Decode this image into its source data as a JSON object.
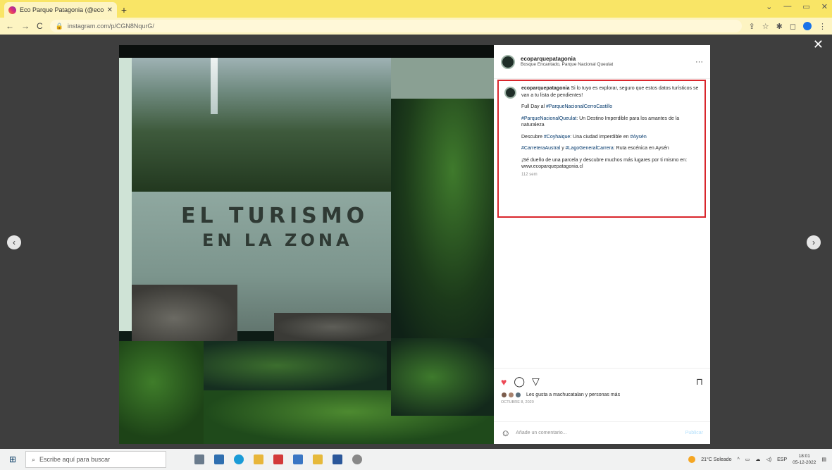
{
  "browser": {
    "tab_title": "Eco Parque Patagonia (@ecopar...",
    "tab_close": "✕",
    "new_tab": "+",
    "url": "instagram.com/p/CGN8NqurG/",
    "window_controls": [
      "⌄",
      "—",
      "▭",
      "✕"
    ]
  },
  "overlay": {
    "close": "✕",
    "prev": "‹",
    "next": "›"
  },
  "post_image": {
    "title_line1": "EL TURISMO",
    "title_line2": "EN LA ZONA"
  },
  "post": {
    "username": "ecoparquepatagonia",
    "location": "Bosque Encantado, Parque Nacional Queulat",
    "more": "···",
    "caption": {
      "username": "ecoparquepatagonia",
      "intro": " Si lo tuyo es explorar, seguro que estos datos turísticos se van a tu lista de pendientes!",
      "p1_prefix": "Full Day al ",
      "p1_tag": "#ParqueNacionalCerroCastillo",
      "p2_tag": "#ParqueNacionalQueulat",
      "p2_text": ": Un Destino Imperdible para los amantes de la naturaleza",
      "p3_prefix": "Descubre ",
      "p3_tag1": "#Coyhaique",
      "p3_mid": ": Una ciudad imperdible en ",
      "p3_tag2": "#Aysén",
      "p4_tag1": "#CarreteraAustral",
      "p4_mid": " y ",
      "p4_tag2": "#LagoGeneralCarrera",
      "p4_text": ": Ruta escénica en Aysén",
      "p5": "¡Sé dueño de una parcela y descubre muchos más lugares por ti mismo en: www.ecoparquepatagonia.cl",
      "time": "112 sem"
    },
    "likes_text": "Les gusta a machucatalan y personas más",
    "date": "OCTUBRE 8, 2020",
    "comment_placeholder": "Añade un comentario...",
    "publish": "Publicar"
  },
  "taskbar": {
    "search_placeholder": "Escribe aquí para buscar",
    "weather": "21°C Soleado",
    "lang": "ESP",
    "time": "18:01",
    "date": "05-12-2022"
  },
  "colors": {
    "accent_red": "#d9262c",
    "heart": "#ed4956",
    "hashtag": "#00376b"
  }
}
